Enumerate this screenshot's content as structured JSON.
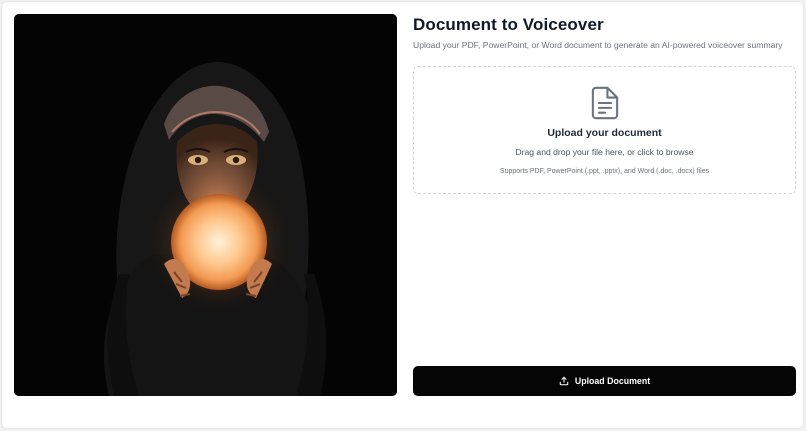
{
  "header": {
    "title": "Document to Voiceover",
    "subtitle": "Upload your PDF, PowerPoint, or Word document to generate an AI-powered voiceover summary"
  },
  "illustration": {
    "subject": "hooded figure holding a glowing orb",
    "icon": "artwork-image"
  },
  "dropzone": {
    "icon": "document-icon",
    "title": "Upload your document",
    "hint": "Drag and drop your file here, or click to browse",
    "supports": "Supports PDF, PowerPoint (.ppt, .pptx), and Word (.doc, .docx) files"
  },
  "actions": {
    "upload_icon": "upload-icon",
    "upload_label": "Upload Document"
  },
  "colors": {
    "button_bg": "#050505",
    "button_text": "#ffffff",
    "dropzone_border": "#d1d5db",
    "title": "#111827",
    "muted": "#6b7280",
    "orb_glow": "#ffb874"
  }
}
